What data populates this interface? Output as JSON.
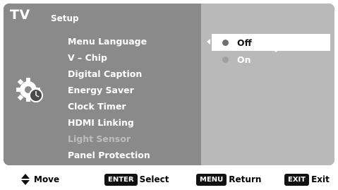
{
  "header": {
    "tv_label": "TV",
    "section_title": "Setup"
  },
  "menu": {
    "items": [
      {
        "label": "Menu Language",
        "state": "selected"
      },
      {
        "label": "V – Chip",
        "state": "normal"
      },
      {
        "label": "Digital Caption",
        "state": "normal"
      },
      {
        "label": "Energy Saver",
        "state": "normal"
      },
      {
        "label": "Clock Timer",
        "state": "normal"
      },
      {
        "label": "HDMI Linking",
        "state": "normal"
      },
      {
        "label": "Light Sensor",
        "state": "disabled"
      },
      {
        "label": "Panel Protection",
        "state": "normal"
      }
    ]
  },
  "options": {
    "items": [
      {
        "label": "Off",
        "selected": true
      },
      {
        "label": "On",
        "selected": false
      }
    ]
  },
  "footer": {
    "move_label": "Move",
    "enter_key": "ENTER",
    "enter_label": "Select",
    "menu_key": "MENU",
    "menu_label": "Return",
    "exit_key": "EXIT",
    "exit_label": "Exit"
  },
  "colors": {
    "panel": "#8a8a8a",
    "options_panel": "#b9b9b9",
    "highlight": "#ffffff"
  },
  "icons": {
    "category": "gear-clock-icon",
    "move": "up-down-arrows-icon",
    "left": "arrow-left-icon",
    "down": "arrow-down-icon"
  }
}
